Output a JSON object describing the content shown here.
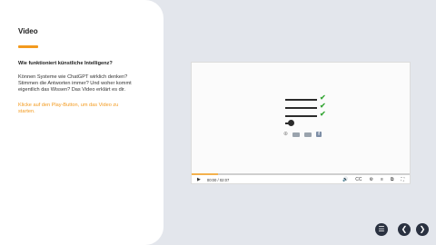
{
  "panel": {
    "title": "Video",
    "question": "Wie funktioniert künstliche Intelligenz?",
    "body": "Können Systeme wie ChatGPT wirklich denken? Stimmen die Antworten immer? Und woher kommt eigentlich das Wissen? Das Video erklärt es dir.",
    "hint": "Klicke auf den Play-Button, um das Video zu starten."
  },
  "player": {
    "time": "00:00 / 02:07",
    "progress_played": 0.0,
    "progress_buffered": 0.12
  },
  "icons": {
    "play": "▶",
    "volume": "🔊",
    "captions": "CC",
    "settings": "⚙",
    "chapters": "≡",
    "pip": "⧉",
    "fullscreen": "⛶",
    "menu": "☰",
    "prev": "❮",
    "next": "❯",
    "check": "✔",
    "globe": "⊕",
    "facebook": "f"
  },
  "colors": {
    "accent": "#f39a1e",
    "check": "#3aa83a",
    "nav": "#2a3140"
  }
}
